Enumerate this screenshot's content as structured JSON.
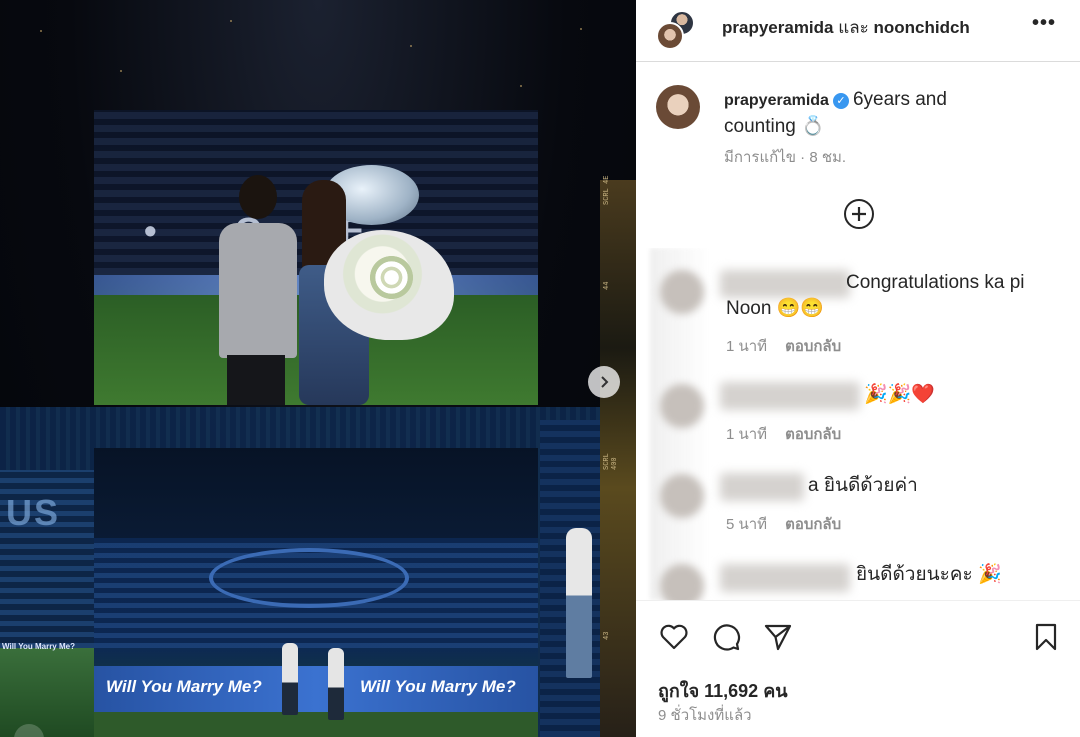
{
  "post": {
    "header_users": "prapyeramida",
    "header_conj": "และ",
    "header_coauthor": "noonchidch",
    "more_icon": "ellipsis-icon"
  },
  "caption": {
    "username": "prapyeramida",
    "text": "6years and counting 💍",
    "edited": "มีการแก้ไข",
    "time": "8 ชม."
  },
  "media": {
    "banner_text": "Will You Marry Me?",
    "banner_text_small": "Will You Marry Me?",
    "film_labels": [
      "SCRL 4E",
      "44",
      "SCRL 400",
      "43"
    ]
  },
  "comments": [
    {
      "text": "Congratulations ka pi Noon 😁😁",
      "time": "1 นาที",
      "reply": "ตอบกลับ"
    },
    {
      "text": "🎉🎉❤️",
      "time": "1 นาที",
      "reply": "ตอบกลับ"
    },
    {
      "text": "a ยินดีด้วยค่า",
      "time": "5 นาที",
      "reply": "ตอบกลับ"
    },
    {
      "text": "ยินดีด้วยนะคะ 🎉"
    }
  ],
  "footer": {
    "likes": "ถูกใจ 11,692 คน",
    "posted": "9 ชั่วโมงที่แล้ว"
  },
  "colors": {
    "verified": "#3897f0",
    "meta": "#8e8e8e",
    "text": "#262626",
    "banner": "#2f63b8"
  }
}
